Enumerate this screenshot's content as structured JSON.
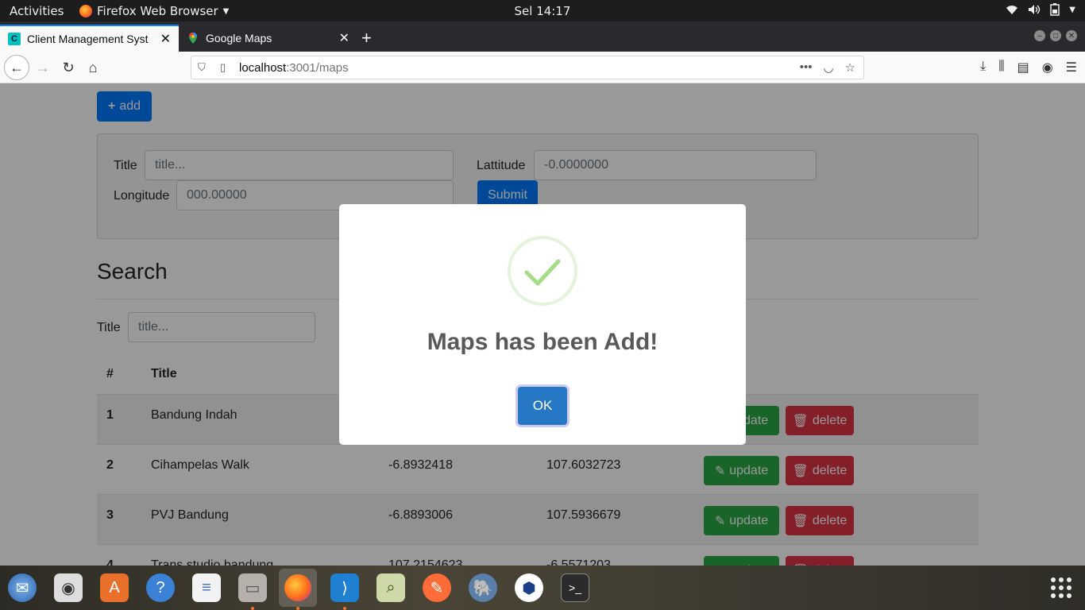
{
  "topbar": {
    "activities": "Activities",
    "app_menu": "Firefox Web Browser",
    "clock": "Sel 14:17"
  },
  "browser": {
    "tabs": [
      {
        "label": "Client Management Syst",
        "favicon": "C",
        "active": true
      },
      {
        "label": "Google Maps",
        "favicon": "maps-pin-icon",
        "active": false
      }
    ],
    "url_host": "localhost",
    "url_path": ":3001/maps"
  },
  "page": {
    "add_button": "add",
    "form": {
      "title_label": "Title",
      "title_placeholder": "title...",
      "lat_label": "Lattitude",
      "lat_placeholder": "-0.0000000",
      "lng_label": "Longitude",
      "lng_placeholder": "000.00000",
      "submit": "Submit"
    },
    "search": {
      "heading": "Search",
      "title_label": "Title",
      "title_placeholder": "title..."
    },
    "table": {
      "headers": [
        "#",
        "Title"
      ],
      "rows": [
        {
          "num": "1",
          "title": "Bandung Indah",
          "lat": "",
          "lng": ""
        },
        {
          "num": "2",
          "title": "Cihampelas Walk",
          "lat": "-6.8932418",
          "lng": "107.6032723"
        },
        {
          "num": "3",
          "title": "PVJ Bandung",
          "lat": "-6.8893006",
          "lng": "107.5936679"
        },
        {
          "num": "4",
          "title": "Trans studio bandung",
          "lat": "107.2154623",
          "lng": "-6.5571203"
        }
      ],
      "update_label": "update",
      "delete_label": "delete"
    }
  },
  "modal": {
    "title": "Maps has been Add!",
    "ok": "OK"
  },
  "colors": {
    "primary": "#007bff",
    "success": "#28a745",
    "danger": "#dc3545",
    "ok_button": "#2778c4",
    "checkmark": "#a5dc86"
  }
}
